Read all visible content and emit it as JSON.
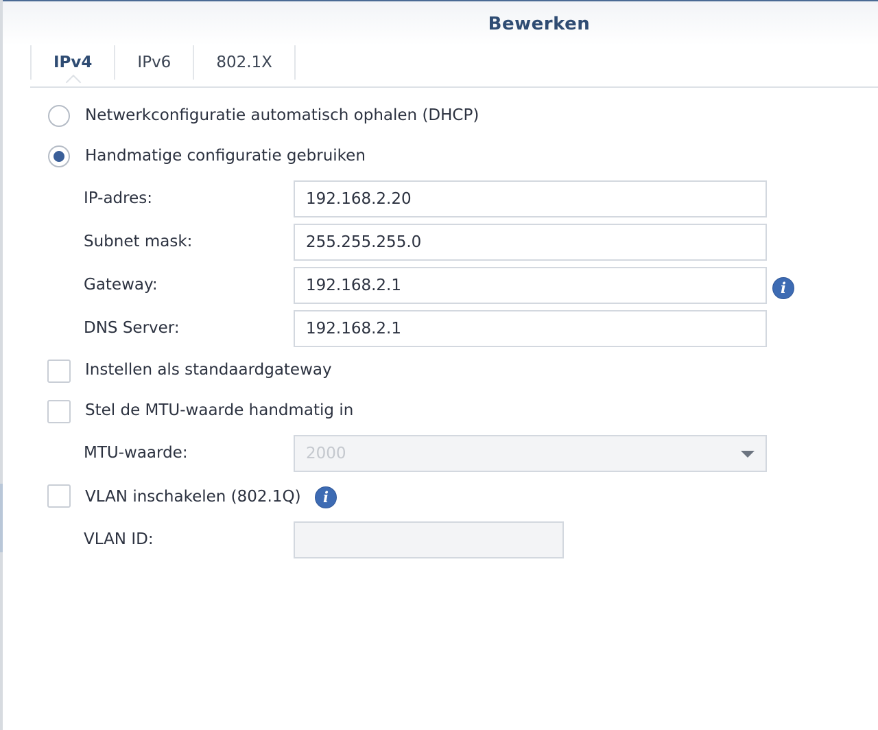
{
  "dialog": {
    "title": "Bewerken"
  },
  "tabs": [
    {
      "label": "IPv4",
      "active": true
    },
    {
      "label": "IPv6",
      "active": false
    },
    {
      "label": "802.1X",
      "active": false
    }
  ],
  "ipv4": {
    "dhcp_option": {
      "label": "Netwerkconfiguratie automatisch ophalen (DHCP)",
      "selected": false
    },
    "manual_option": {
      "label": "Handmatige configuratie gebruiken",
      "selected": true
    },
    "ip_address": {
      "label": "IP-adres:",
      "value": "192.168.2.20"
    },
    "subnet_mask": {
      "label": "Subnet mask:",
      "value": "255.255.255.0"
    },
    "gateway": {
      "label": "Gateway:",
      "value": "192.168.2.1"
    },
    "dns_server": {
      "label": "DNS Server:",
      "value": "192.168.2.1"
    },
    "default_gateway": {
      "label": "Instellen als standaardgateway",
      "checked": false
    },
    "mtu_manual": {
      "label": "Stel de MTU-waarde handmatig in",
      "checked": false
    },
    "mtu_value": {
      "label": "MTU-waarde:",
      "value": "2000"
    },
    "vlan_enable": {
      "label": "VLAN inschakelen (802.1Q)",
      "checked": false
    },
    "vlan_id": {
      "label": "VLAN ID:",
      "value": ""
    }
  },
  "icons": {
    "info": "i"
  },
  "colors": {
    "accent": "#3a5f99",
    "title": "#2f4c73",
    "info_icon": "#3d6bb3"
  }
}
